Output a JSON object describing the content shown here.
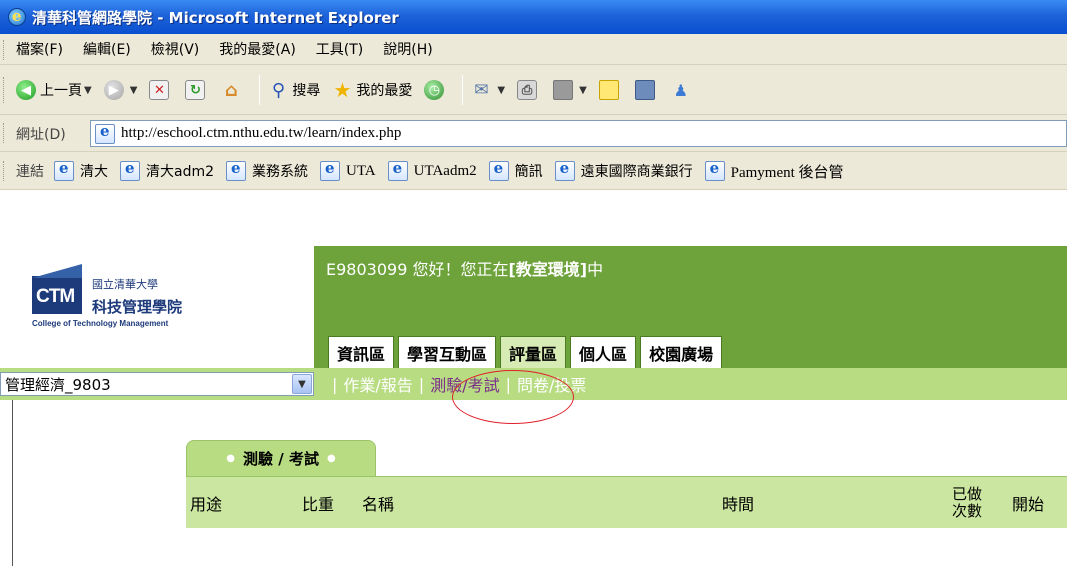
{
  "window": {
    "title": "清華科管網路學院 - Microsoft Internet Explorer"
  },
  "menu": [
    "檔案(F)",
    "編輯(E)",
    "檢視(V)",
    "我的最愛(A)",
    "工具(T)",
    "說明(H)"
  ],
  "toolbar": {
    "back_label": "上一頁",
    "search_label": "搜尋",
    "favorites_label": "我的最愛"
  },
  "address": {
    "label": "網址(D)",
    "url": "http://eschool.ctm.nthu.edu.tw/learn/index.php"
  },
  "links": {
    "label": "連結",
    "items": [
      "清大",
      "清大adm2",
      "業務系統",
      "UTA",
      "UTAadm2",
      "簡訊",
      "遠東國際商業銀行",
      "Pamyment 後台管"
    ]
  },
  "logo": {
    "university": "國立清華大學",
    "mark": "CTM",
    "school": "科技管理學院",
    "english": "College of Technology Management"
  },
  "header": {
    "welcome_prefix": "E9803099 您好！您正在",
    "welcome_location": "[教室環境]",
    "welcome_suffix": "中"
  },
  "nav_tabs": [
    "資訊區",
    "學習互動區",
    "評量區",
    "個人區",
    "校園廣場"
  ],
  "course_select": {
    "value": "管理經濟_9803"
  },
  "sub_nav": [
    "作業/報告",
    "測驗/考試",
    "問卷/投票"
  ],
  "panel": {
    "tab_label": "測驗 / 考試",
    "columns": [
      "用途",
      "比重",
      "名稱",
      "時間",
      "已做",
      "次數",
      "開始"
    ]
  },
  "colors": {
    "title_bar": "#1d62d8",
    "header_green": "#6ea23a",
    "sub_green": "#b7dc82",
    "table_header": "#cbe6a0",
    "active_link": "#7b2e8a",
    "annotation_circle": "#e0202a"
  }
}
